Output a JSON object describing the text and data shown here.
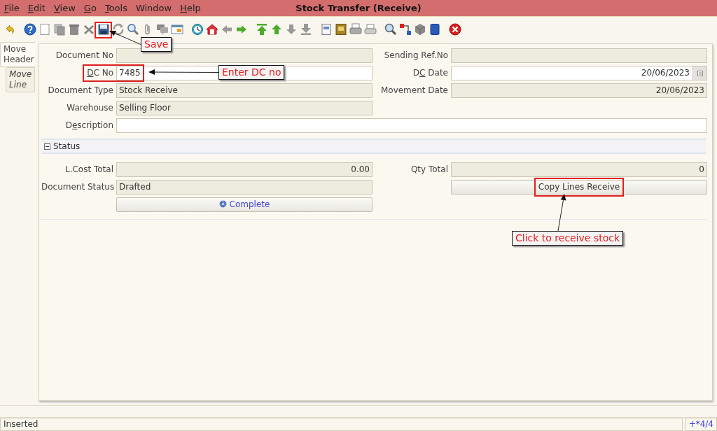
{
  "window": {
    "title": "Stock Transfer (Receive)"
  },
  "menu": [
    {
      "label": {
        "key": "F",
        "post": "ile"
      }
    },
    {
      "label": {
        "key": "E",
        "post": "dit"
      }
    },
    {
      "label": {
        "key": "V",
        "post": "iew"
      }
    },
    {
      "label": {
        "key": "G",
        "post": "o"
      }
    },
    {
      "label": {
        "key": "T",
        "post": "ools"
      }
    },
    {
      "label": "Window"
    },
    {
      "label": {
        "key": "H",
        "post": "elp"
      }
    }
  ],
  "toolbar_groups": [
    [
      {
        "kind": "undo",
        "highlighted": false
      }
    ],
    [
      {
        "kind": "help",
        "highlighted": false
      },
      {
        "kind": "new",
        "highlighted": false
      },
      {
        "kind": "copy",
        "highlighted": false
      },
      {
        "kind": "delete",
        "highlighted": false
      },
      {
        "kind": "delete-selection",
        "highlighted": false
      },
      {
        "kind": "save",
        "highlighted": true
      },
      {
        "kind": "refresh",
        "highlighted": false
      },
      {
        "kind": "find",
        "highlighted": false
      },
      {
        "kind": "attach",
        "highlighted": false
      },
      {
        "kind": "chat",
        "highlighted": false
      },
      {
        "kind": "grid",
        "highlighted": false
      }
    ],
    [
      {
        "kind": "history",
        "highlighted": false
      },
      {
        "kind": "home",
        "highlighted": false
      },
      {
        "kind": "back",
        "highlighted": false
      },
      {
        "kind": "forward",
        "highlighted": false
      }
    ],
    [
      {
        "kind": "first",
        "highlighted": false
      },
      {
        "kind": "prev",
        "highlighted": false
      },
      {
        "kind": "next",
        "highlighted": false
      },
      {
        "kind": "last",
        "highlighted": false
      }
    ],
    [
      {
        "kind": "report",
        "highlighted": false
      },
      {
        "kind": "archive",
        "highlighted": false
      },
      {
        "kind": "print",
        "highlighted": false
      },
      {
        "kind": "preview",
        "highlighted": false
      }
    ],
    [
      {
        "kind": "zoom",
        "highlighted": false
      },
      {
        "kind": "workflow",
        "highlighted": false
      },
      {
        "kind": "product",
        "highlighted": false
      },
      {
        "kind": "window",
        "highlighted": false
      }
    ],
    [
      {
        "kind": "exit",
        "highlighted": false
      }
    ]
  ],
  "side_tabs": [
    {
      "label": "Move Header",
      "selected": true
    },
    {
      "label": "Move Line",
      "selected": false
    }
  ],
  "header_rows": [
    {
      "left": {
        "label": "Document No",
        "kind": "readonly"
      },
      "right": {
        "label": "Sending Ref.No",
        "kind": "readonly"
      }
    },
    {
      "left": {
        "label": {
          "key": "D",
          "post": "C No"
        },
        "kind": "input",
        "value": "7485",
        "highlighted": true
      },
      "right": {
        "label": {
          "pre": "D",
          "key": "C",
          "post": " Date"
        },
        "kind": "date",
        "value": "20/06/2023"
      }
    },
    {
      "left": {
        "label": "Document Type",
        "kind": "readonly",
        "value": "Stock Receive"
      },
      "right": {
        "label": "Movement Date",
        "kind": "readonly-number",
        "value": "20/06/2023"
      }
    },
    {
      "left": {
        "label": "Warehouse",
        "kind": "readonly",
        "value": "Selling Floor"
      }
    },
    {
      "left": {
        "label": {
          "pre": "D",
          "key": "e",
          "post": "scription"
        },
        "kind": "input-wide"
      }
    }
  ],
  "status_section": {
    "title": "Status",
    "expanded": true,
    "rows": [
      {
        "left": {
          "label": "L.Cost Total",
          "kind": "readonly-number",
          "value": "0.00"
        },
        "right": {
          "label": "Qty Total",
          "kind": "readonly-number",
          "value": "0"
        }
      },
      {
        "left": {
          "label": "Document Status",
          "kind": "readonly",
          "value": "Drafted"
        },
        "right": {
          "kind": "button",
          "label": "Copy Lines Receive",
          "highlighted": true
        }
      },
      {
        "left": {
          "kind": "button",
          "label": "Complete",
          "icon": true,
          "highlighted": false
        }
      }
    ]
  },
  "annotations": [
    {
      "text": "Save"
    },
    {
      "text": "Enter DC no"
    },
    {
      "text": "Click to receive stock"
    }
  ],
  "status_bar": {
    "message": "Inserted",
    "record": "+*4/4"
  }
}
